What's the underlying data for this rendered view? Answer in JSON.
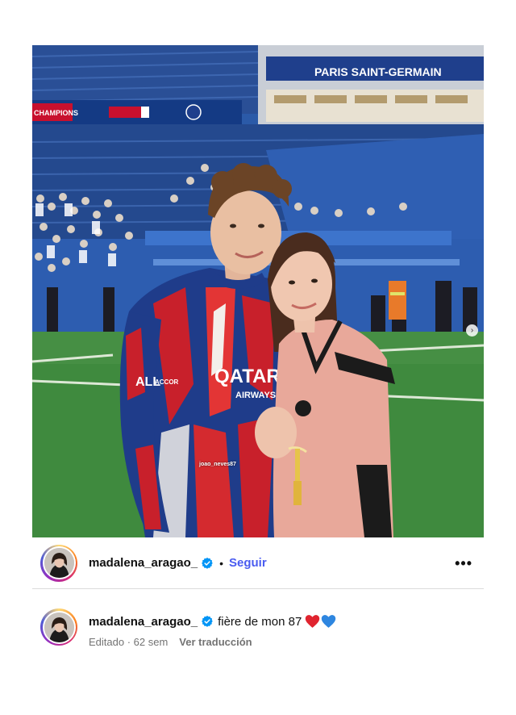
{
  "post": {
    "username": "madalena_aragao_",
    "follow_label": "Seguir",
    "separator": "•",
    "more_label": "•••",
    "photo": {
      "tag_label": "joao_neves87",
      "banner_text": "PARIS SAINT-GERMAIN",
      "banner_left_text": "CHAMPIONS",
      "jersey_sponsor_line1": "QATAR",
      "jersey_sponsor_line2": "AIRWAYS",
      "jersey_sleeve_text": "ALL",
      "jersey_sleeve_text2": "ACCOR",
      "next_icon": "›"
    }
  },
  "caption": {
    "username": "madalena_aragao_",
    "text": "fière de mon 87",
    "emojis": [
      "red-heart",
      "blue-heart"
    ],
    "edited_label": "Editado",
    "meta_separator": " · ",
    "time": "62 sem",
    "translate_label": "Ver traducción"
  },
  "colors": {
    "follow_blue": "#4a5cf0",
    "verified_blue": "#0095f6",
    "meta_gray": "#737373",
    "pitch_green": "#3f8a3e",
    "stadium_blue": "#2b5aa8"
  }
}
